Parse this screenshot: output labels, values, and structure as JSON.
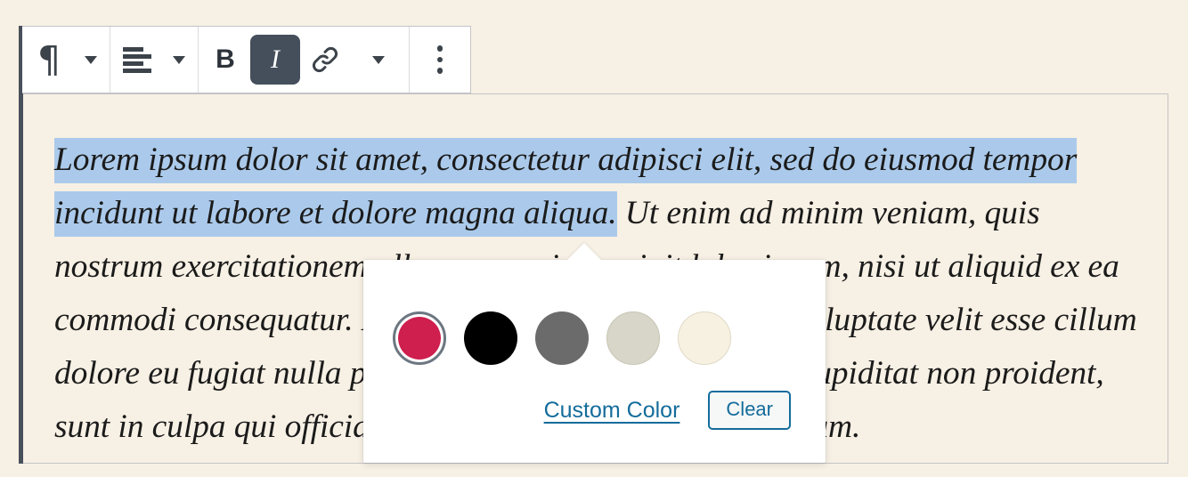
{
  "theme": {
    "page_background": "#F7F0E4",
    "block_border": "#C3C4C7",
    "selection_highlight": "#ABCAEB",
    "active_button_background": "#454F5C",
    "link_blue": "#136C9B",
    "block_selection_bar": "#49505C"
  },
  "toolbar": {
    "groups": [
      {
        "name": "block-type",
        "buttons": [
          {
            "name": "paragraph-block-type-button",
            "icon": "pilcrow-icon",
            "label": "¶",
            "active": false
          },
          {
            "name": "block-type-dropdown-button",
            "icon": "chevron-down-icon",
            "label": "",
            "active": false
          }
        ]
      },
      {
        "name": "alignment",
        "buttons": [
          {
            "name": "align-text-left-button",
            "icon": "align-left-icon",
            "label": "",
            "active": false
          },
          {
            "name": "alignment-dropdown-button",
            "icon": "chevron-down-icon",
            "label": "",
            "active": false
          }
        ]
      },
      {
        "name": "formatting",
        "buttons": [
          {
            "name": "bold-button",
            "icon": "bold-icon",
            "label": "B",
            "active": false
          },
          {
            "name": "italic-button",
            "icon": "italic-icon",
            "label": "I",
            "active": true
          },
          {
            "name": "link-button",
            "icon": "link-icon",
            "label": "",
            "active": false
          },
          {
            "name": "more-formatting-dropdown-button",
            "icon": "chevron-down-icon",
            "label": "",
            "active": false
          }
        ]
      },
      {
        "name": "options",
        "buttons": [
          {
            "name": "more-options-button",
            "icon": "vertical-dots-icon",
            "label": "",
            "active": false
          }
        ]
      }
    ]
  },
  "content": {
    "selected_text": "Lorem ipsum dolor sit amet, consectetur adipisci elit, sed do eiusmod tempor incidunt ut labore et dolore magna aliqua.",
    "unselected_text": " Ut enim ad minim veniam, quis nostrum exercitationem ullam corporis suscipit laboriosam, nisi ut aliquid ex ea commodi consequatur. Duis aute irure reprehenderit in voluptate velit esse cillum dolore eu fugiat nulla pariatur. Excepteur sint obcaecat cupiditat non proident, sunt in culpa qui officia deserunt mollit anim id est laborum."
  },
  "color_popover": {
    "swatches": [
      {
        "name": "swatch-crimson",
        "color": "#CE1F4E",
        "selected": true,
        "border": "none"
      },
      {
        "name": "swatch-black",
        "color": "#000000",
        "selected": false,
        "border": "none"
      },
      {
        "name": "swatch-gray",
        "color": "#6B6B6B",
        "selected": false,
        "border": "none"
      },
      {
        "name": "swatch-stone",
        "color": "#D8D6C8",
        "selected": false,
        "border": "#C8C5B5"
      },
      {
        "name": "swatch-cream",
        "color": "#F7F1E1",
        "selected": false,
        "border": "#DFD9C6"
      }
    ],
    "custom_color_label": "Custom Color",
    "clear_label": "Clear"
  }
}
